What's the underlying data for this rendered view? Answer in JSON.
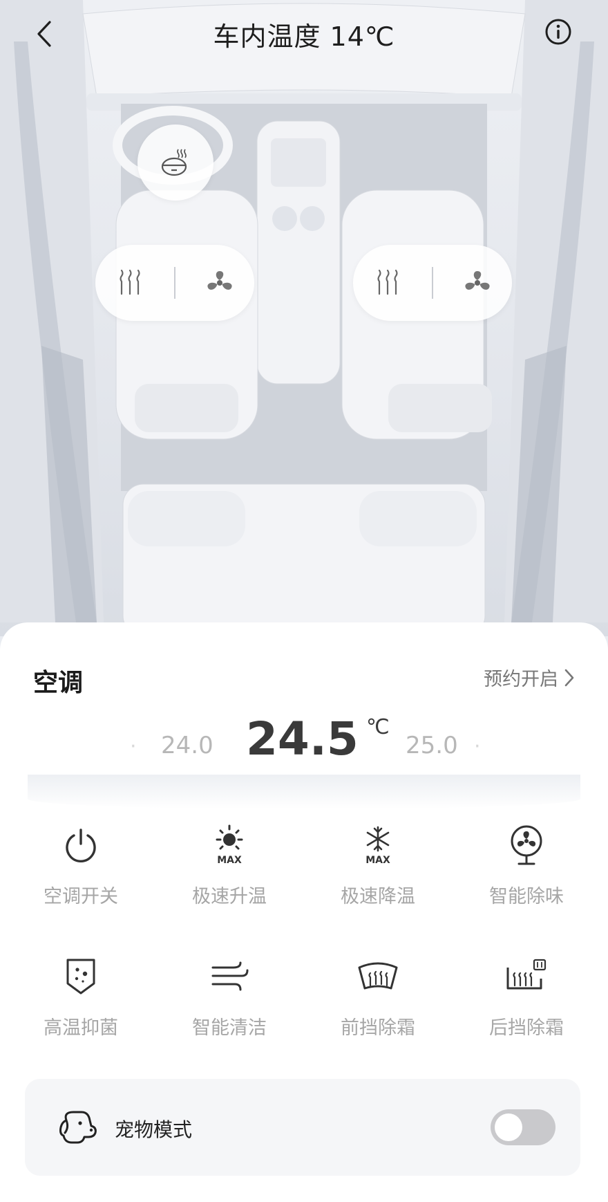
{
  "header": {
    "title": "车内温度 14℃",
    "back_icon": "chevron-left-icon",
    "info_icon": "info-circle-icon"
  },
  "car_controls": {
    "steering_heat_icon": "steering-wheel-heat-icon",
    "left_seat": {
      "heat_icon": "seat-heat-icon",
      "vent_icon": "fan-icon"
    },
    "right_seat": {
      "heat_icon": "seat-heat-icon",
      "vent_icon": "fan-icon"
    }
  },
  "ac_panel": {
    "title": "空调",
    "schedule_label": "预约开启",
    "temperature": {
      "previous": "24.0",
      "current": "24.5",
      "unit": "℃",
      "next": "25.0"
    },
    "functions": [
      {
        "label": "空调开关",
        "icon": "power-icon"
      },
      {
        "label": "极速升温",
        "icon": "sun-max-icon"
      },
      {
        "label": "极速降温",
        "icon": "snowflake-max-icon"
      },
      {
        "label": "智能除味",
        "icon": "deodorize-fan-icon"
      },
      {
        "label": "高温抑菌",
        "icon": "shield-bacteria-icon"
      },
      {
        "label": "智能清洁",
        "icon": "wind-clean-icon"
      },
      {
        "label": "前挡除霜",
        "icon": "front-defrost-icon"
      },
      {
        "label": "后挡除霜",
        "icon": "rear-defrost-icon"
      }
    ],
    "pet_mode": {
      "label": "宠物模式",
      "icon": "dog-icon",
      "enabled": false
    }
  },
  "colors": {
    "label_gray": "#a6a6a6",
    "toggle_off": "#c9c9cc",
    "text_dark": "#222222"
  }
}
